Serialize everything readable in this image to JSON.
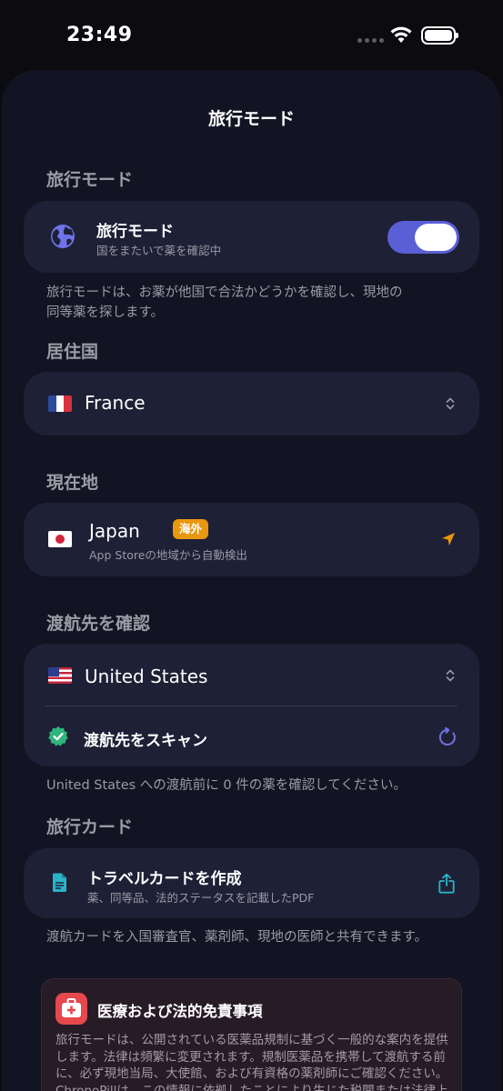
{
  "status_bar": {
    "time": "23:49"
  },
  "nav": {
    "title": "旅行モード"
  },
  "travel_mode_section": {
    "header": "旅行モード",
    "row_title": "旅行モード",
    "row_subtitle": "国をまたいで薬を確認中",
    "toggle_on": true,
    "footnote_line1": "旅行モードは、お薬が他国で合法かどうかを確認し、現地の",
    "footnote_line2": "同等薬を探します。"
  },
  "residence_section": {
    "header": "居住国",
    "country": "France"
  },
  "current_location_section": {
    "header": "現在地",
    "country": "Japan",
    "badge": "海外",
    "subtitle": "App Storeの地域から自動検出"
  },
  "destination_section": {
    "header": "渡航先を確認",
    "country": "United States",
    "scan_label": "渡航先をスキャン",
    "footnote": "United States への渡航前に 0 件の薬を確認してください。"
  },
  "travel_card_section": {
    "header": "旅行カード",
    "row_title": "トラベルカードを作成",
    "row_subtitle": "薬、同等品、法的ステータスを記載したPDF",
    "footnote": "渡航カードを入国審査官、薬剤師、現地の医師と共有できます。"
  },
  "disclaimer": {
    "title": "医療および法的免責事項",
    "line1": "旅行モードは、公開されている医薬品規制に基づく一般的な案内を提供",
    "line2": "します。法律は頻繁に変更されます。規制医薬品を携帯して渡航する前",
    "line3": "に、必ず現地当局、大使館、および有資格の薬剤師にご確認ください。",
    "line4": "ChronoPillは、この情報に依拠したことにより生じた税関または法律上の"
  },
  "colors": {
    "background": "#0b0b10",
    "sheet": "#121423",
    "card": "#1e2036",
    "accent": "#5b5fd6",
    "badge": "#e8970f",
    "teal": "#2ab4c7",
    "check_green": "#2fb67c",
    "danger": "#e5484d"
  },
  "icons": [
    "wifi-icon",
    "battery-icon",
    "globe-icon",
    "chevron-up-down-icon",
    "location-arrow-icon",
    "verified-check-icon",
    "refresh-icon",
    "document-icon",
    "share-icon",
    "medical-kit-icon"
  ]
}
